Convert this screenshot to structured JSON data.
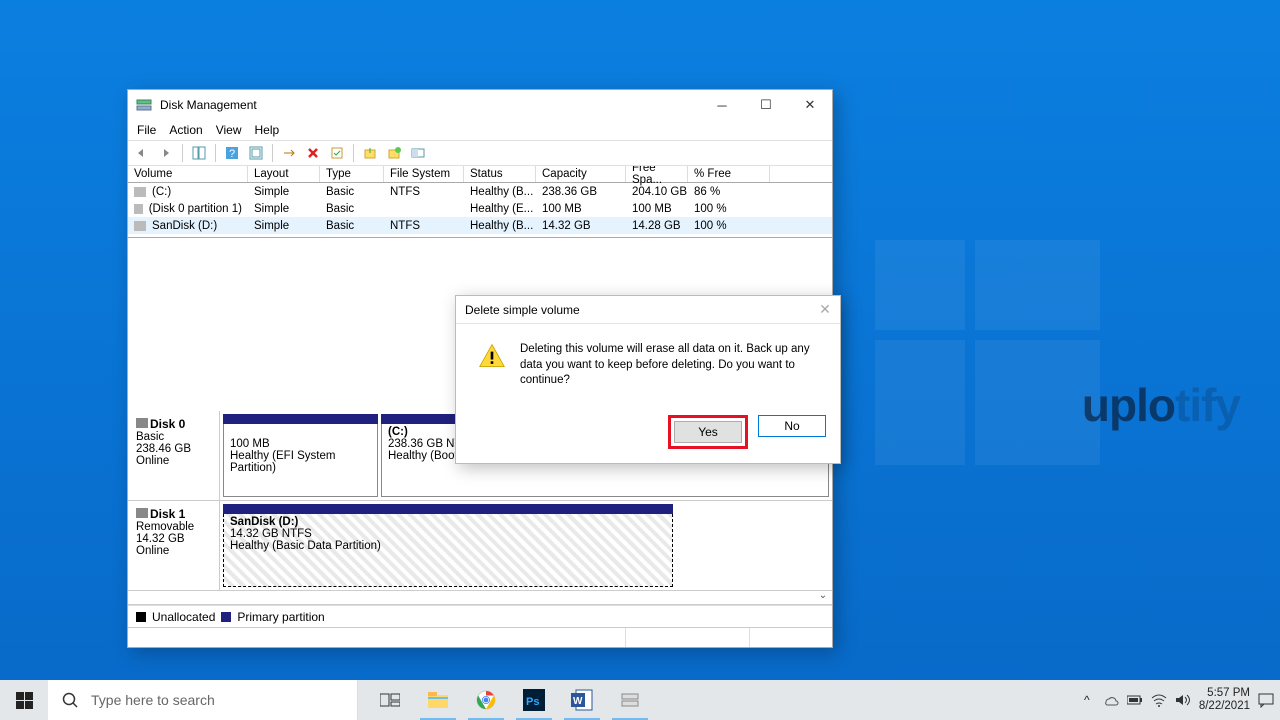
{
  "window": {
    "title": "Disk Management",
    "menu": {
      "file": "File",
      "action": "Action",
      "view": "View",
      "help": "Help"
    },
    "columns": {
      "volume": "Volume",
      "layout": "Layout",
      "type": "Type",
      "fs": "File System",
      "status": "Status",
      "cap": "Capacity",
      "free": "Free Spa...",
      "pfree": "% Free"
    },
    "rows": [
      {
        "volume": "(C:)",
        "layout": "Simple",
        "type": "Basic",
        "fs": "NTFS",
        "status": "Healthy (B...",
        "cap": "238.36 GB",
        "free": "204.10 GB",
        "pfree": "86 %"
      },
      {
        "volume": "(Disk 0 partition 1)",
        "layout": "Simple",
        "type": "Basic",
        "fs": "",
        "status": "Healthy (E...",
        "cap": "100 MB",
        "free": "100 MB",
        "pfree": "100 %"
      },
      {
        "volume": "SanDisk (D:)",
        "layout": "Simple",
        "type": "Basic",
        "fs": "NTFS",
        "status": "Healthy (B...",
        "cap": "14.32 GB",
        "free": "14.28 GB",
        "pfree": "100 %"
      }
    ],
    "disk0": {
      "label": "Disk 0",
      "kind": "Basic",
      "size": "238.46 GB",
      "state": "Online",
      "p1_size": "100 MB",
      "p1_status": "Healthy (EFI System Partition)",
      "p2_name": "(C:)",
      "p2_size": "238.36 GB NTFS",
      "p2_status": "Healthy (Boot, Page File, Crash Dump, Basic Data Partition)"
    },
    "disk1": {
      "label": "Disk 1",
      "kind": "Removable",
      "size": "14.32 GB",
      "state": "Online",
      "p1_name": "SanDisk  (D:)",
      "p1_size": "14.32 GB NTFS",
      "p1_status": "Healthy (Basic Data Partition)"
    },
    "legend": {
      "unalloc": "Unallocated",
      "primary": "Primary partition"
    }
  },
  "dialog": {
    "title": "Delete simple volume",
    "message": "Deleting this volume will erase all data on it. Back up any data you want to keep before deleting. Do you want to continue?",
    "yes": "Yes",
    "no": "No"
  },
  "taskbar": {
    "search_placeholder": "Type here to search",
    "time": "5:57 PM",
    "date": "8/22/2021"
  },
  "watermark": {
    "a": "uplo",
    "b": "tify"
  }
}
